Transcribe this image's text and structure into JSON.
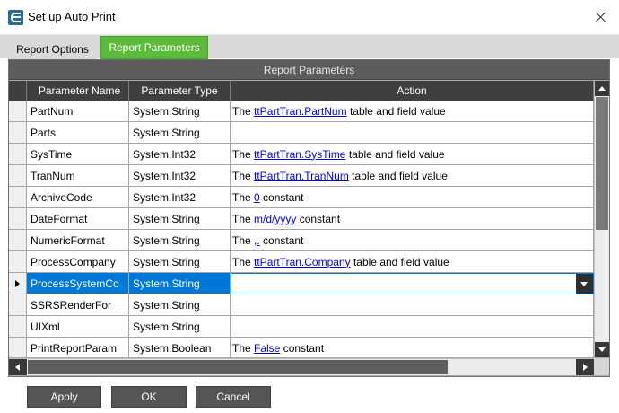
{
  "window": {
    "title": "Set up Auto Print",
    "close_label": "Close"
  },
  "tabs": [
    {
      "label": "Report Options"
    },
    {
      "label": "Report Parameters"
    }
  ],
  "grid": {
    "caption": "Report Parameters",
    "columns": [
      "Parameter Name",
      "Parameter Type",
      "Action"
    ],
    "rows": [
      {
        "name": "PartNum",
        "type": "System.String",
        "pre": "The ",
        "link": "ttPartTran.PartNum",
        "post": " table and field value"
      },
      {
        "name": "Parts",
        "type": "System.String",
        "pre": "",
        "link": "",
        "post": ""
      },
      {
        "name": "SysTime",
        "type": "System.Int32",
        "pre": "The ",
        "link": "ttPartTran.SysTime",
        "post": " table and field value"
      },
      {
        "name": "TranNum",
        "type": "System.Int32",
        "pre": "The ",
        "link": "ttPartTran.TranNum",
        "post": " table and field value"
      },
      {
        "name": "ArchiveCode",
        "type": "System.Int32",
        "pre": "The ",
        "link": "0",
        "post": " constant"
      },
      {
        "name": "DateFormat",
        "type": "System.String",
        "pre": "The ",
        "link": "m/d/yyyy",
        "post": " constant"
      },
      {
        "name": "NumericFormat",
        "type": "System.String",
        "pre": "The ",
        "link": ",.",
        "post": " constant"
      },
      {
        "name": "ProcessCompany",
        "type": "System.String",
        "pre": "The ",
        "link": "ttPartTran.Company",
        "post": " table and field value"
      },
      {
        "name": "ProcessSystemCo",
        "type": "System.String",
        "pre": "",
        "link": "",
        "post": "",
        "selected": true
      },
      {
        "name": "SSRSRenderFor",
        "type": "System.String",
        "pre": "",
        "link": "",
        "post": ""
      },
      {
        "name": "UIXml",
        "type": "System.String",
        "pre": "",
        "link": "",
        "post": ""
      },
      {
        "name": "PrintReportParam",
        "type": "System.Boolean",
        "pre": "The ",
        "link": "False",
        "post": " constant"
      }
    ]
  },
  "buttons": {
    "apply": "Apply",
    "ok": "OK",
    "cancel": "Cancel"
  },
  "colors": {
    "active_tab": "#5dbb3b",
    "header_bg": "#3f3f3f",
    "caption_bg": "#5c5c5c",
    "selection": "#0078d7",
    "button_bg": "#555555",
    "link": "#0000ee"
  },
  "icons": {
    "app": "epicor-e-icon",
    "close": "close-icon",
    "row_pointer": "row-pointer-icon",
    "dropdown": "chevron-down-icon"
  }
}
